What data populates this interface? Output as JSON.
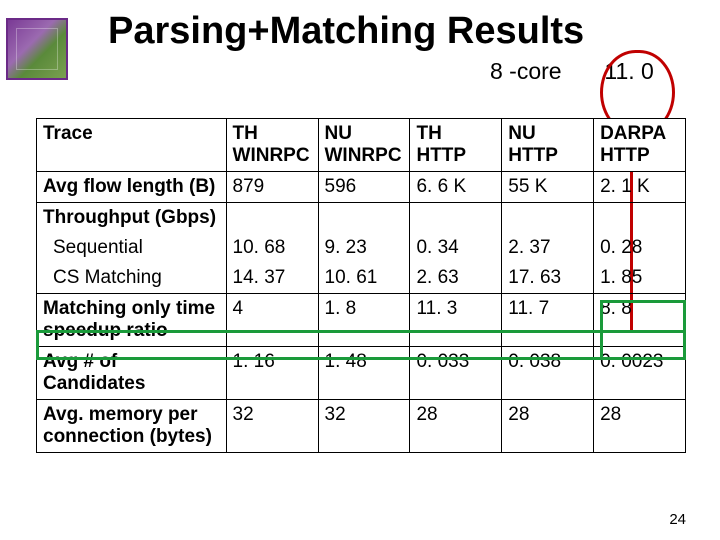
{
  "title": "Parsing+Matching Results",
  "subtitle": "8 -core",
  "oval_value": "11. 0",
  "page_number": "24",
  "columns": [
    "Trace",
    "TH WINRPC",
    "NU WINRPC",
    "TH HTTP",
    "NU HTTP",
    "DARPA HTTP"
  ],
  "rows": {
    "avg_flow_label": "Avg flow length (B)",
    "avg_flow": [
      "879",
      "596",
      "6. 6 K",
      "55 K",
      "2. 1 K"
    ],
    "throughput_label": "Throughput (Gbps)",
    "sequential_label": "Sequential",
    "sequential": [
      "10. 68",
      "9. 23",
      "0. 34",
      "2. 37",
      "0. 28"
    ],
    "csmatch_label": "CS Matching",
    "csmatch": [
      "14. 37",
      "10. 61",
      "2. 63",
      "17. 63",
      "1. 85"
    ],
    "speedup_label": "Matching only time speedup ratio",
    "speedup": [
      "4",
      "1. 8",
      "11. 3",
      "11. 7",
      "8. 8"
    ],
    "candidates_label": "Avg # of Candidates",
    "candidates": [
      "1. 16",
      "1. 48",
      "0. 033",
      "0. 038",
      "0. 0023"
    ],
    "memory_label": "Avg. memory per connection (bytes)",
    "memory": [
      "32",
      "32",
      "28",
      "28",
      "28"
    ]
  }
}
